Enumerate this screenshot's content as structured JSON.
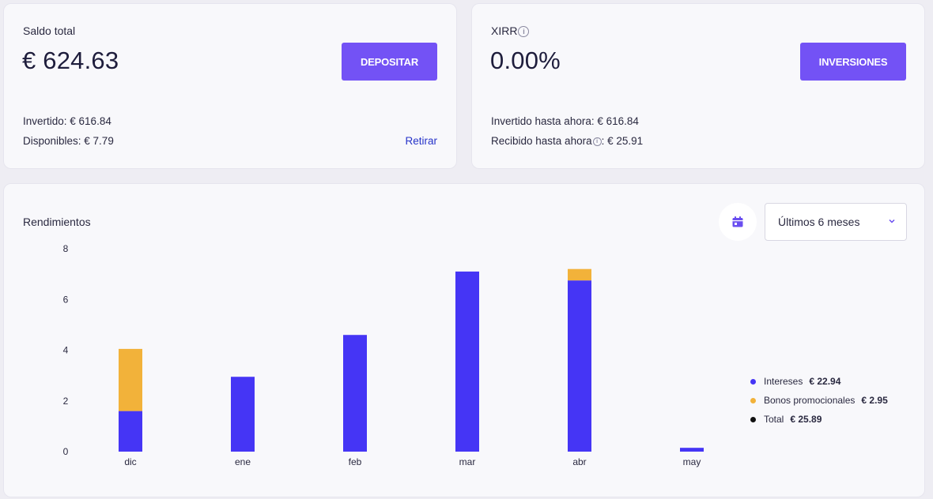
{
  "saldo": {
    "label": "Saldo total",
    "value": "€ 624.63",
    "button": "DEPOSITAR",
    "invested": "Invertido: € 616.84",
    "available": "Disponibles: € 7.79",
    "withdraw": "Retirar"
  },
  "xirr": {
    "label": "XIRR",
    "value": "0.00%",
    "button": "INVERSIONES",
    "invested": "Invertido hasta ahora: € 616.84",
    "received_label": "Recibido hasta ahora",
    "received_value": ": € 25.91"
  },
  "rendimientos": {
    "title": "Rendimientos",
    "period": "Últimos 6 meses",
    "calendar_icon": "calendar-icon",
    "legend": [
      {
        "name": "Intereses",
        "value": "€ 22.94",
        "color": "#4535f5"
      },
      {
        "name": "Bonos promocionales",
        "value": "€ 2.95",
        "color": "#f2b23a"
      },
      {
        "name": "Total",
        "value": "€ 25.89",
        "color": "#111111"
      }
    ]
  },
  "chart_data": {
    "type": "bar",
    "stacked": true,
    "categories": [
      "dic",
      "ene",
      "feb",
      "mar",
      "abr",
      "may"
    ],
    "series": [
      {
        "name": "Intereses",
        "color": "#4535f5",
        "values": [
          1.6,
          2.95,
          4.6,
          7.1,
          6.75,
          0.15
        ]
      },
      {
        "name": "Bonos promocionales",
        "color": "#f2b23a",
        "values": [
          2.45,
          0,
          0,
          0,
          0.45,
          0
        ]
      }
    ],
    "yticks": [
      "0",
      "2",
      "4",
      "6",
      "8"
    ],
    "ylim": [
      0,
      8
    ],
    "grid": false,
    "legend_position": "right"
  }
}
